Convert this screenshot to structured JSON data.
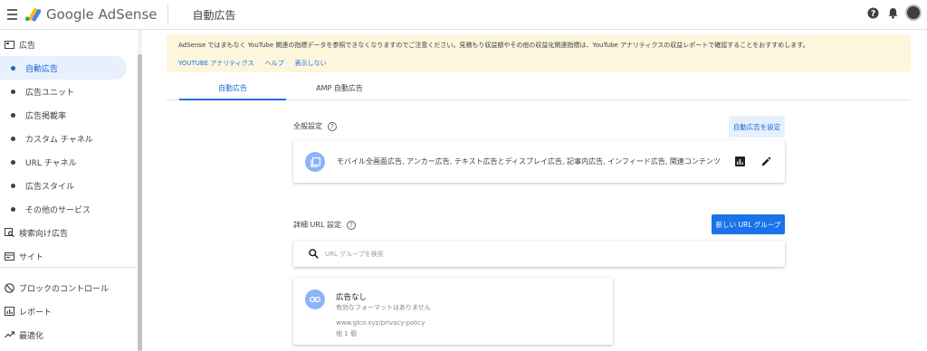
{
  "header": {
    "logo_text": "Google AdSense",
    "page_title": "自動広告"
  },
  "sidebar": {
    "items": [
      {
        "label": "広告",
        "icon": "ad-frame-icon"
      },
      {
        "label": "自動広告",
        "active": true
      },
      {
        "label": "広告ユニット"
      },
      {
        "label": "広告掲載率"
      },
      {
        "label": "カスタム チャネル"
      },
      {
        "label": "URL チャネル"
      },
      {
        "label": "広告スタイル"
      },
      {
        "label": "その他のサービス"
      },
      {
        "label": "検索向け広告",
        "icon": "search-ads-icon"
      },
      {
        "label": "サイト",
        "icon": "sites-icon"
      },
      {
        "label": "ブロックのコントロール",
        "icon": "block-icon"
      },
      {
        "label": "レポート",
        "icon": "reports-icon"
      },
      {
        "label": "最適化",
        "icon": "trending-icon"
      }
    ]
  },
  "notice": {
    "text": "AdSense ではまもなく YouTube 関連の指標データを参照できなくなりますのでご注意ください。見積もり収益額やその他の収益化関連指標は、YouTube アナリティクスの収益レポートで確認することをおすすめします。",
    "links": [
      "YOUTUBE アナリティクス",
      "ヘルプ",
      "表示しない"
    ]
  },
  "tabs": [
    "自動広告",
    "AMP 自動広告"
  ],
  "general": {
    "label": "全般設定",
    "help": "?",
    "button": "自動広告を設定",
    "formats": "モバイル全画面広告, アンカー広告, テキスト広告とディスプレイ広告, 記事内広告, インフィード広告, 関連コンテンツ"
  },
  "url_settings": {
    "label": "詳細 URL 設定",
    "help": "?",
    "button": "新しい URL グループ",
    "search_placeholder": "URL グループを検索"
  },
  "url_group": {
    "title": "広告なし",
    "subtitle": "有効なフォーマットはありません",
    "url": "www.glco.xyz/privacy-policy",
    "count": "他 1 個"
  },
  "colors": {
    "accent": "#1a73e8",
    "notice_bg": "#fdf6dc",
    "active_bg": "#e8f0fe"
  }
}
